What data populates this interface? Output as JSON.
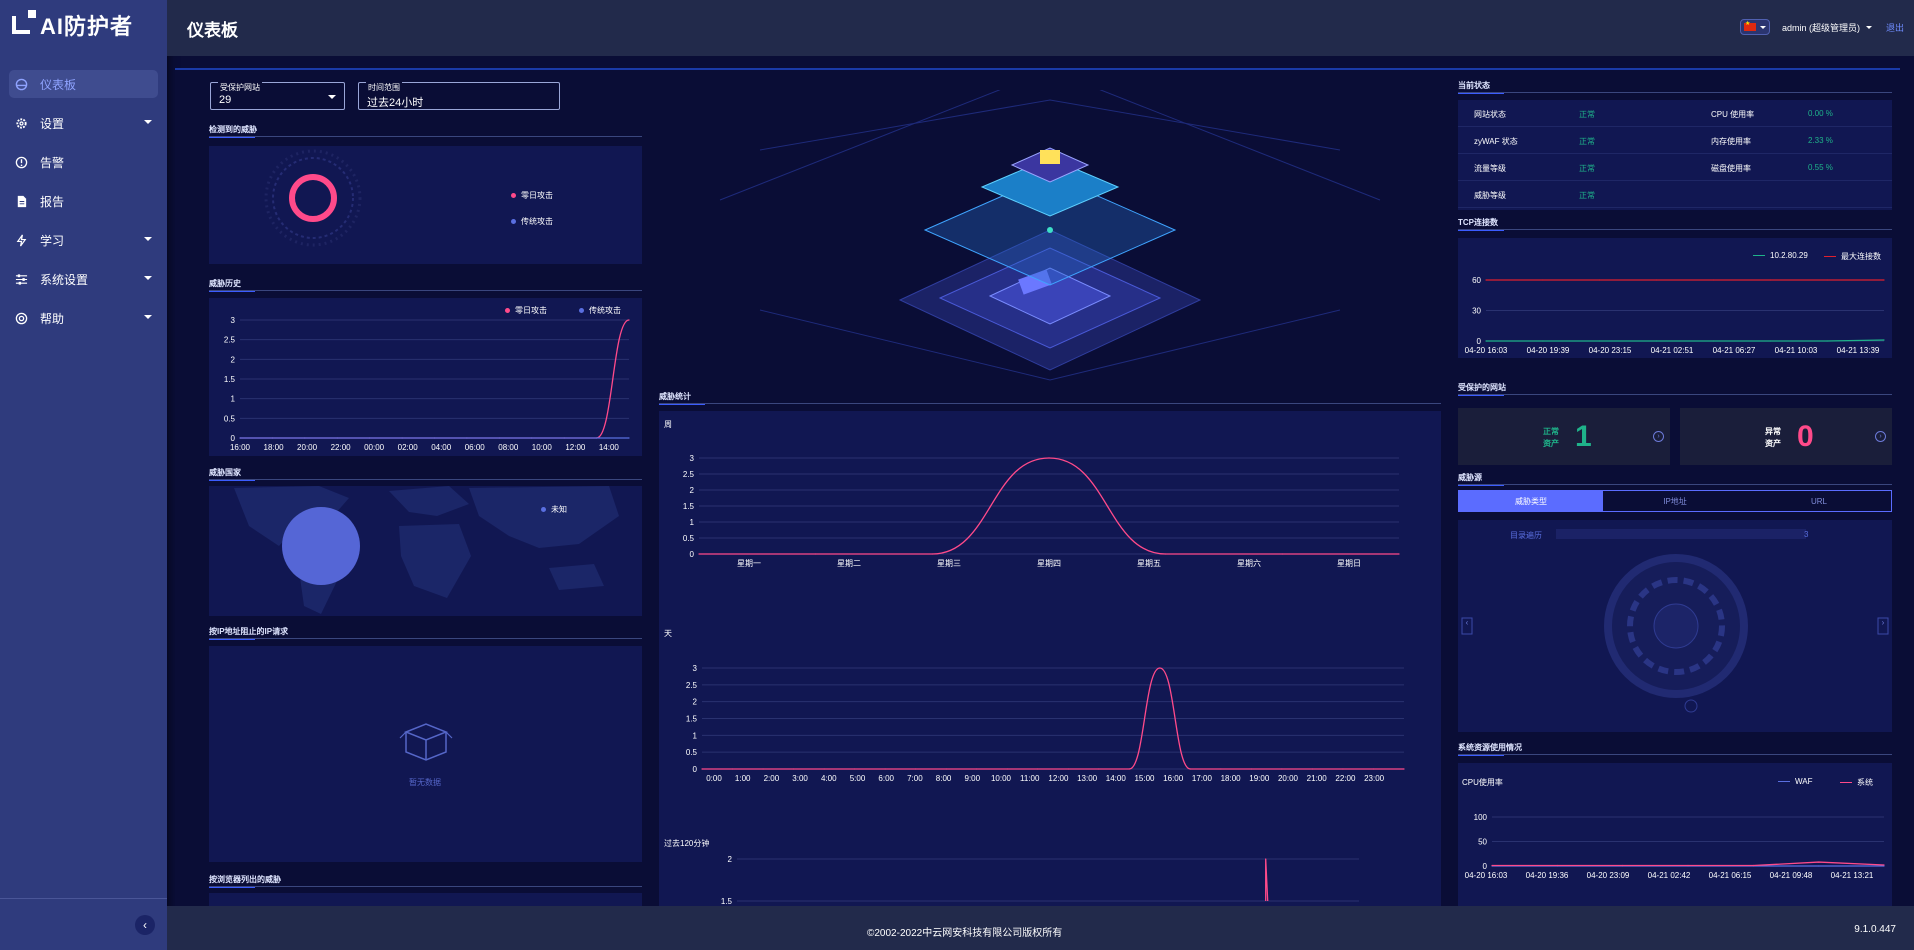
{
  "app": {
    "name": "AI防护者",
    "page_title": "仪表板",
    "version": "9.1.0.447",
    "copyright": "©2002-2022中云网安科技有限公司版权所有"
  },
  "user": {
    "label": "admin (超级管理员)",
    "logout": "退出"
  },
  "sidebar": {
    "items": [
      {
        "label": "仪表板",
        "icon": "dashboard-icon",
        "active": true
      },
      {
        "label": "设置",
        "icon": "gear-icon",
        "expandable": true
      },
      {
        "label": "告警",
        "icon": "alert-icon"
      },
      {
        "label": "报告",
        "icon": "report-icon"
      },
      {
        "label": "学习",
        "icon": "bolt-icon",
        "expandable": true
      },
      {
        "label": "系统设置",
        "icon": "sliders-icon",
        "expandable": true
      },
      {
        "label": "帮助",
        "icon": "help-icon",
        "expandable": true
      }
    ]
  },
  "filters": {
    "site": {
      "label": "受保护网站",
      "value": "29"
    },
    "time": {
      "label": "时间范围",
      "value": "过去24小时"
    }
  },
  "sections": {
    "detected_threats": "检测到的威胁",
    "threat_history": "威胁历史",
    "threat_country": "威胁国家",
    "blocked_ip": "按IP地址阻止的IP请求",
    "browser_threats": "按浏览器列出的威胁",
    "threat_stats": "威胁统计",
    "current_status": "当前状态",
    "tcp": "TCP连接数",
    "protected_sites": "受保护的网站",
    "threat_source": "威胁源",
    "resources": "系统资源使用情况"
  },
  "legend": {
    "zero_day": "零日攻击",
    "traditional": "传统攻击",
    "unknown": "未知",
    "ip": "10.2.80.29",
    "max_conn": "最大连接数",
    "waf": "WAF",
    "system": "系统"
  },
  "empty": "暂无数据",
  "stats_labels": {
    "week": "周",
    "day": "天",
    "last120": "过去120分钟",
    "cpu": "CPU使用率"
  },
  "status": {
    "rows": [
      {
        "k1": "网站状态",
        "v1": "正常",
        "k2": "CPU 使用率",
        "v2": "0.00 %"
      },
      {
        "k1": "zyWAF 状态",
        "v1": "正常",
        "k2": "内存使用率",
        "v2": "2.33 %"
      },
      {
        "k1": "流量等级",
        "v1": "正常",
        "k2": "磁盘使用率",
        "v2": "0.55 %"
      },
      {
        "k1": "威胁等级",
        "v1": "正常",
        "k2": "",
        "v2": ""
      }
    ]
  },
  "assets": {
    "normal_label": "正常资产",
    "normal": "1",
    "abnormal_label": "异常资产",
    "abnormal": "0"
  },
  "threat_source": {
    "tabs": [
      "威胁类型",
      "IP地址",
      "URL"
    ],
    "row_label": "目录遍历",
    "row_value": "3"
  },
  "colors": {
    "accent": "#5b6cff",
    "pink": "#ff4a8a",
    "blue": "#5a6fe0",
    "green": "#1fb38a",
    "red": "#e0202e"
  },
  "chart_data": [
    {
      "type": "line",
      "title": "威胁历史",
      "categories": [
        "16:00",
        "18:00",
        "20:00",
        "22:00",
        "00:00",
        "02:00",
        "04:00",
        "06:00",
        "08:00",
        "10:00",
        "12:00",
        "14:00"
      ],
      "ylim": [
        0,
        3
      ],
      "yticks": [
        0,
        0.5,
        1,
        1.5,
        2,
        2.5,
        3
      ],
      "series": [
        {
          "name": "零日攻击",
          "values": [
            0,
            0,
            0,
            0,
            0,
            0,
            0,
            0,
            0,
            0,
            0,
            0,
            3
          ]
        },
        {
          "name": "传统攻击",
          "values": [
            0,
            0,
            0,
            0,
            0,
            0,
            0,
            0,
            0,
            0,
            0,
            0,
            0
          ]
        }
      ]
    },
    {
      "type": "line",
      "title": "周",
      "categories": [
        "星期一",
        "星期二",
        "星期三",
        "星期四",
        "星期五",
        "星期六",
        "星期日"
      ],
      "ylim": [
        0,
        3
      ],
      "yticks": [
        0,
        0.5,
        1,
        1.5,
        2,
        2.5,
        3
      ],
      "series": [
        {
          "name": "零日攻击",
          "values": [
            0,
            0,
            0,
            3,
            0,
            0,
            0
          ]
        }
      ]
    },
    {
      "type": "line",
      "title": "天",
      "categories": [
        "0:00",
        "1:00",
        "2:00",
        "3:00",
        "4:00",
        "5:00",
        "6:00",
        "7:00",
        "8:00",
        "9:00",
        "10:00",
        "11:00",
        "12:00",
        "13:00",
        "14:00",
        "15:00",
        "16:00",
        "17:00",
        "18:00",
        "19:00",
        "20:00",
        "21:00",
        "22:00",
        "23:00"
      ],
      "ylim": [
        0,
        3
      ],
      "yticks": [
        0,
        0.5,
        1,
        1.5,
        2,
        2.5,
        3
      ],
      "series": [
        {
          "name": "零日攻击",
          "values": [
            0,
            0,
            0,
            0,
            0,
            0,
            0,
            0,
            0,
            0,
            0,
            0,
            0,
            0,
            0,
            3,
            0,
            0,
            0,
            0,
            0,
            0,
            0,
            0
          ]
        }
      ]
    },
    {
      "type": "line",
      "title": "过去120分钟",
      "ylim": [
        1.5,
        2
      ],
      "yticks": [
        1.5,
        2
      ],
      "series": [
        {
          "name": "零日攻击",
          "values": [
            2
          ]
        }
      ]
    },
    {
      "type": "line",
      "title": "TCP连接数",
      "categories": [
        "04-20 16:03",
        "04-20 19:39",
        "04-20 23:15",
        "04-21 02:51",
        "04-21 06:27",
        "04-21 10:03",
        "04-21 13:39"
      ],
      "ylim": [
        0,
        60
      ],
      "yticks": [
        0,
        30,
        60
      ],
      "series": [
        {
          "name": "10.2.80.29",
          "values": [
            0,
            0,
            0,
            0,
            0,
            0,
            0,
            1
          ]
        },
        {
          "name": "最大连接数",
          "values": [
            60,
            60,
            60,
            60,
            60,
            60,
            60,
            60
          ]
        }
      ]
    },
    {
      "type": "line",
      "title": "CPU使用率",
      "categories": [
        "04-20 16:03",
        "04-20 19:36",
        "04-20 23:09",
        "04-21 02:42",
        "04-21 06:15",
        "04-21 09:48",
        "04-21 13:21"
      ],
      "ylim": [
        0,
        100
      ],
      "yticks": [
        0,
        50,
        100
      ],
      "series": [
        {
          "name": "WAF",
          "values": [
            0,
            0,
            0,
            0,
            0,
            0,
            0
          ]
        },
        {
          "name": "系统",
          "values": [
            1,
            1,
            1,
            1,
            1,
            8,
            2
          ]
        }
      ]
    }
  ]
}
